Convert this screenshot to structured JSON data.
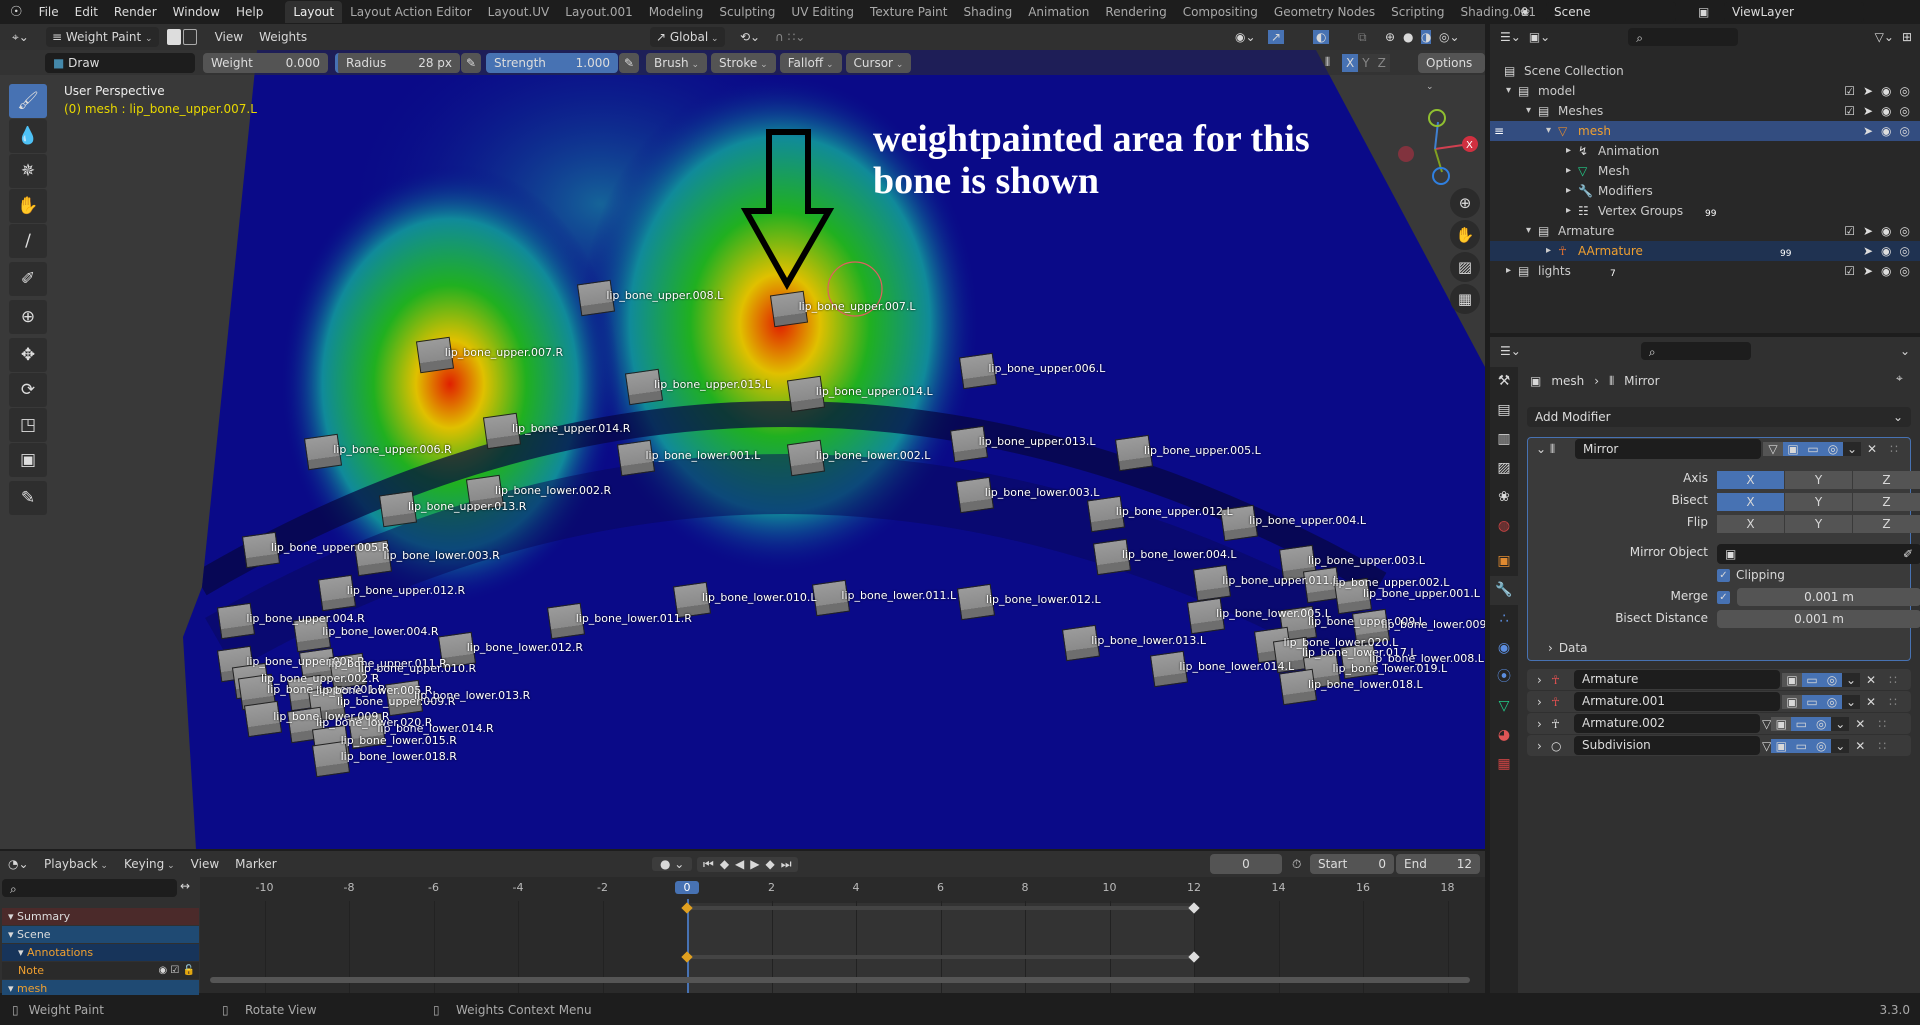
{
  "menubar": {
    "menus": [
      "File",
      "Edit",
      "Render",
      "Window",
      "Help"
    ],
    "workspaces": [
      "Layout",
      "Layout Action Editor",
      "Layout.UV",
      "Layout.001",
      "Modeling",
      "Sculpting",
      "UV Editing",
      "Texture Paint",
      "Shading",
      "Animation",
      "Rendering",
      "Compositing",
      "Geometry Nodes",
      "Scripting",
      "Shading.001"
    ],
    "active_workspace": "Layout",
    "add_tab": "+",
    "scene": "Scene",
    "view_layer": "ViewLayer"
  },
  "header": {
    "mode": "Weight Paint",
    "view": "View",
    "weights": "Weights",
    "orientation": "Global"
  },
  "tool_settings": {
    "brush": "Draw",
    "weight_label": "Weight",
    "weight_value": "0.000",
    "radius_label": "Radius",
    "radius_value": "28 px",
    "strength_label": "Strength",
    "strength_value": "1.000",
    "dropdowns": [
      "Brush",
      "Stroke",
      "Falloff",
      "Cursor"
    ],
    "mirror_axes": [
      "X",
      "Y",
      "Z"
    ],
    "options": "Options"
  },
  "viewport": {
    "perspective": "User Perspective",
    "active_info": "(0) mesh : lip_bone_upper.007.L",
    "annotation_line1": "weightpainted area for this",
    "annotation_line2": "bone is shown",
    "gizmo_axes": [
      "X",
      "Y",
      "Z"
    ],
    "colors": {
      "low": "#0a0a8a",
      "mid": "#00b400",
      "high": "#e00000"
    },
    "bones": [
      "lip_bone_upper.008.L",
      "lip_bone_upper.007.L",
      "lip_bone_upper.007.R",
      "lip_bone_upper.015.L",
      "lip_bone_upper.014.L",
      "lip_bone_upper.006.L",
      "lip_bone_upper.014.R",
      "lip_bone_upper.006.R",
      "lip_bone_lower.001.L",
      "lip_bone_lower.002.L",
      "lip_bone_upper.013.L",
      "lip_bone_upper.005.L",
      "lip_bone_lower.002.R",
      "lip_bone_upper.013.R",
      "lip_bone_lower.003.L",
      "lip_bone_upper.012.L",
      "lip_bone_upper.004.L",
      "lip_bone_upper.005.R",
      "lip_bone_lower.003.R",
      "lip_bone_lower.004.L",
      "lip_bone_upper.003.L",
      "lip_bone_upper.012.R",
      "lip_bone_lower.010.L",
      "lip_bone_lower.011.L",
      "lip_bone_lower.012.L",
      "lip_bone_upper.011.L",
      "lip_bone_upper.002.L",
      "lip_bone_upper.001.L",
      "lip_bone_lower.011.R",
      "lip_bone_upper.004.R",
      "lip_bone_lower.005.L",
      "lip_bone_upper.009.L",
      "lip_bone_lower.009.L",
      "lip_bone_lower.004.R",
      "lip_bone_lower.012.R",
      "lip_bone_lower.013.L",
      "lip_bone_lower.020.L",
      "lip_bone_upper.003.R",
      "lip_bone_upper.011.R",
      "lip_bone_upper.010.R",
      "lip_bone_lower.017.L",
      "lip_bone_lower.008.L",
      "lip_bone_upper.002.R",
      "lip_bone_lower.014.L",
      "lip_bone_lower.019.L",
      "lip_bone_upper.001.R",
      "lip_bone_lower.005.R",
      "lip_bone_upper.009.R",
      "lip_bone_lower.013.R",
      "lip_bone_lower.009.R",
      "lip_bone_lower.020.R",
      "lip_bone_lower.014.R",
      "lip_bone_lower.015.R",
      "lip_bone_lower.018.R",
      "lip_bone_lower.018.L"
    ]
  },
  "outliner": {
    "rows": [
      {
        "label": "Scene Collection",
        "icon": "collection-icon"
      },
      {
        "label": "model",
        "icon": "collection-icon"
      },
      {
        "label": "Meshes",
        "icon": "collection-icon"
      },
      {
        "label": "mesh",
        "icon": "mesh-object-icon"
      },
      {
        "label": "Animation",
        "icon": "animation-icon"
      },
      {
        "label": "Mesh",
        "icon": "mesh-data-icon"
      },
      {
        "label": "Modifiers",
        "icon": "wrench-icon"
      },
      {
        "label": "Vertex Groups",
        "icon": "vertex-groups-icon",
        "badge": "99"
      },
      {
        "label": "Armature",
        "icon": "collection-icon"
      },
      {
        "label": "AArmature",
        "icon": "armature-icon",
        "badge": "99"
      },
      {
        "label": "lights",
        "icon": "collection-icon",
        "badge": "7"
      }
    ]
  },
  "properties": {
    "breadcrumb": [
      "mesh",
      "Mirror"
    ],
    "add_modifier": "Add Modifier",
    "mirror": {
      "name": "Mirror",
      "axis_label": "Axis",
      "bisect_label": "Bisect",
      "flip_label": "Flip",
      "axes": [
        "X",
        "Y",
        "Z"
      ],
      "axis_on": [
        true,
        false,
        false
      ],
      "bisect_on": [
        true,
        false,
        false
      ],
      "flip_on": [
        false,
        false,
        false
      ],
      "mirror_object_label": "Mirror Object",
      "clipping_label": "Clipping",
      "clipping": true,
      "merge_label": "Merge",
      "merge": true,
      "merge_value": "0.001 m",
      "bisect_distance_label": "Bisect Distance",
      "bisect_distance_value": "0.001 m",
      "data_label": "Data"
    },
    "modifiers": [
      "Armature",
      "Armature.001",
      "Armature.002",
      "Subdivision"
    ]
  },
  "timeline": {
    "menus": [
      "Playback",
      "Keying",
      "View",
      "Marker"
    ],
    "current_frame": "0",
    "start_label": "Start",
    "start": "0",
    "end_label": "End",
    "end": "12",
    "ticks": [
      "-10",
      "-8",
      "-6",
      "-4",
      "-2",
      "0",
      "2",
      "4",
      "6",
      "8",
      "10",
      "12",
      "14",
      "16",
      "18"
    ],
    "channels": [
      "Summary",
      "Scene",
      "Annotations",
      "Note",
      "mesh"
    ]
  },
  "status": {
    "left": "Weight Paint",
    "middle": "Rotate View",
    "right": "Weights Context Menu",
    "version": "3.3.0"
  }
}
